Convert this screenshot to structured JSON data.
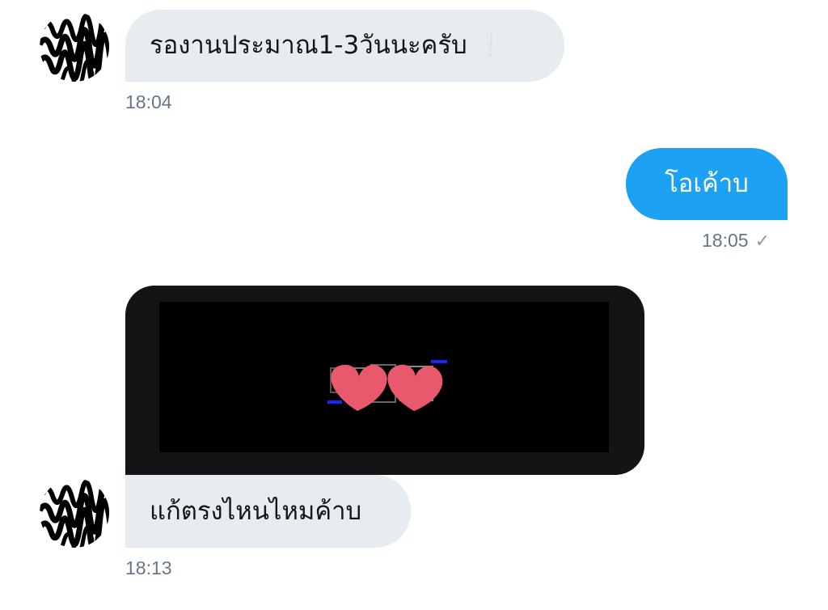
{
  "conversation": {
    "messages": [
      {
        "direction": "incoming",
        "text": "รองานประมาณ1-3วันนะครับ",
        "emoji": "❕",
        "time": "18:04"
      },
      {
        "direction": "outgoing",
        "text": "โอเค้าบ",
        "time": "18:05",
        "status_icon": "read-check-icon",
        "status_glyph": "✓"
      },
      {
        "direction": "incoming",
        "type": "image",
        "content": "black-image-with-heart-stickers"
      },
      {
        "direction": "incoming",
        "text": "แก้ตรงไหนไหมค้าบ",
        "time": "18:13"
      }
    ]
  },
  "colors": {
    "incoming_bubble": "#e6ecf0",
    "outgoing_bubble": "#1da1f2",
    "timestamp": "#657786",
    "heart": "#e8596d"
  }
}
